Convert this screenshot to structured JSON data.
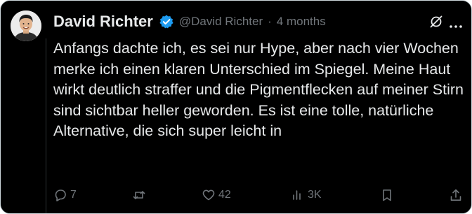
{
  "post": {
    "author_name": "David Richter",
    "handle": "@David Richter",
    "separator": "·",
    "time": "4 months",
    "text": "Anfangs dachte ich, es sei nur Hype, aber nach vier Wochen merke ich einen klaren Unterschied im Spiegel. Meine Haut wirkt deutlich straffer und die Pigmentflecken auf meiner Stirn sind sichtbar heller geworden. Es ist eine tolle, natürliche Alternative, die sich super leicht in"
  },
  "actions": {
    "replies": "7",
    "reposts": "",
    "likes": "42",
    "views": "3K"
  },
  "icons": {
    "verified": "verified-badge-icon",
    "grok": "grok-icon",
    "more": "more-icon",
    "reply": "reply-icon",
    "repost": "repost-icon",
    "like": "heart-icon",
    "views": "views-icon",
    "bookmark": "bookmark-icon",
    "share": "share-icon"
  },
  "colors": {
    "background": "#000000",
    "text": "#e7e9ea",
    "muted": "#71767b",
    "verified_blue": "#1d9bf0",
    "border": "#cfd9de"
  }
}
